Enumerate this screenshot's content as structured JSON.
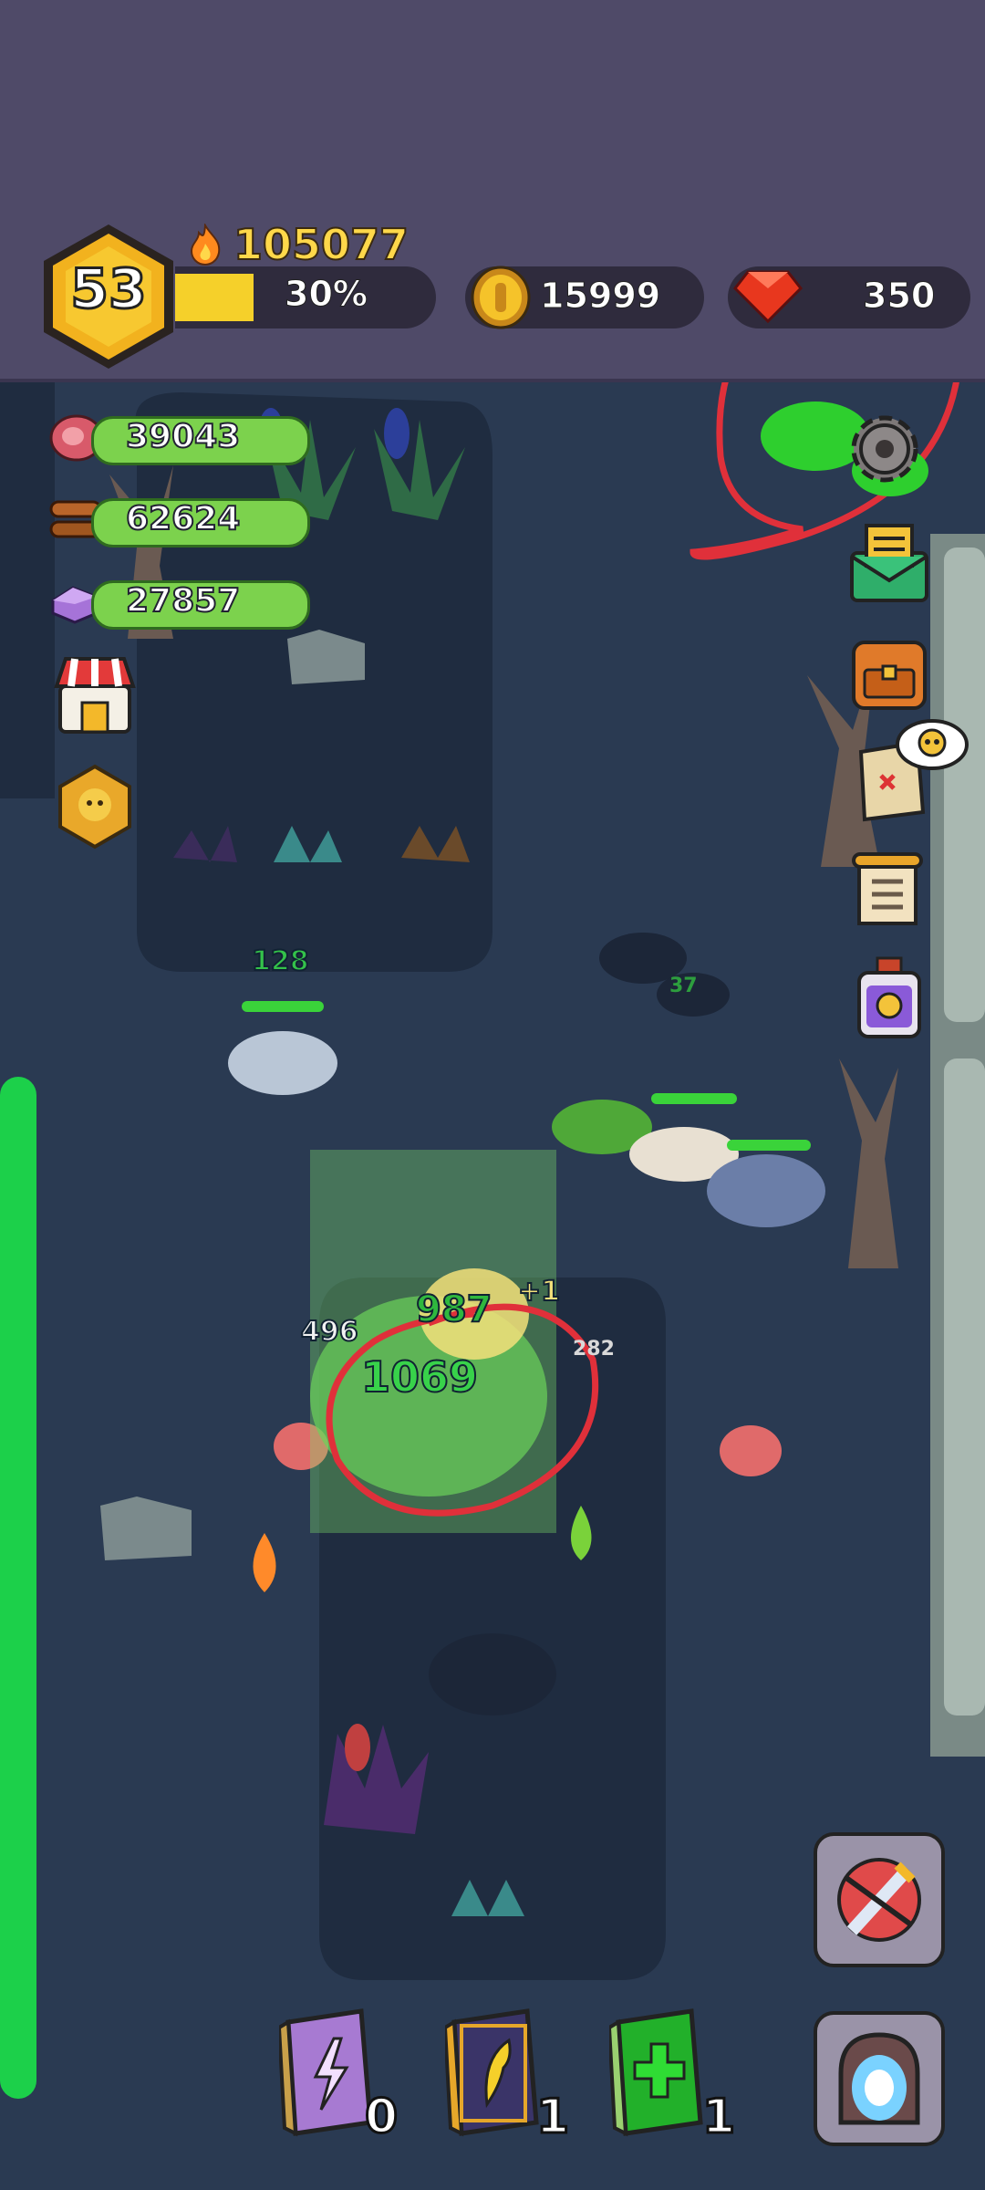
{
  "player": {
    "level": "53",
    "xp_percent_label": "30%",
    "xp_fraction": 0.3
  },
  "power": {
    "value": "105077"
  },
  "currency": {
    "gold": "15999",
    "gems": "350"
  },
  "resources": [
    {
      "icon": "meat-icon",
      "value": "39043"
    },
    {
      "icon": "wood-icon",
      "value": "62624"
    },
    {
      "icon": "crystal-icon",
      "value": "27857"
    }
  ],
  "combat": {
    "floaters": [
      "128",
      "37",
      "1069",
      "496",
      "+1",
      "282",
      "987"
    ]
  },
  "books": [
    {
      "icon": "lightning-book-icon",
      "count": "0"
    },
    {
      "icon": "wing-book-icon",
      "count": "1"
    },
    {
      "icon": "heal-book-icon",
      "count": "1"
    }
  ],
  "colors": {
    "topbar": "#4f4a68",
    "ground": "#2a3a52",
    "path": "#1f2c40",
    "xp": "#f5d02a",
    "annotation": "#e0303a"
  }
}
